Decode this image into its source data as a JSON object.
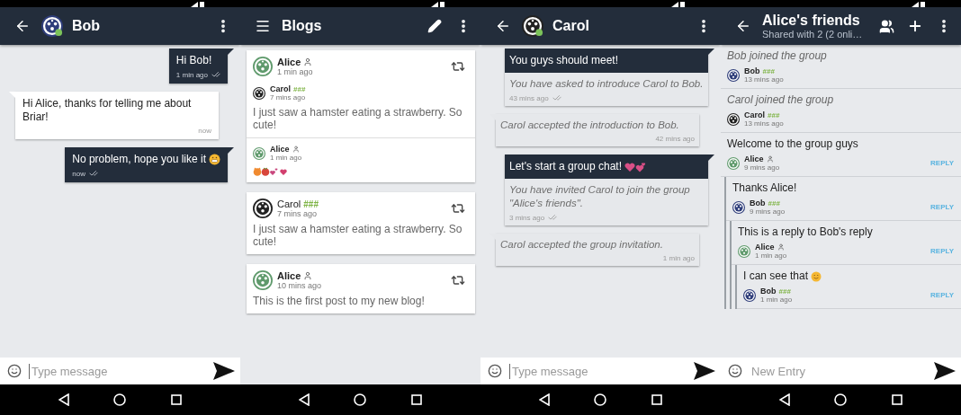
{
  "screens": [
    {
      "kind": "chat",
      "toolbar": {
        "back": true,
        "title": "Bob",
        "avatar": {
          "color": "#2e3d7a",
          "online": true
        }
      },
      "messages": [
        {
          "kind": "text",
          "outgoing": true,
          "text": "Hi Bob!",
          "time": "1 min ago",
          "delivered": true
        },
        {
          "kind": "text",
          "outgoing": false,
          "text": "Hi Alice, thanks for telling me about Briar!",
          "time": "now",
          "delivered": false
        },
        {
          "kind": "text",
          "outgoing": true,
          "text": "No problem, hope you like it",
          "emoji": {
            "kind": "grin"
          },
          "time": "now",
          "delivered": true
        }
      ],
      "composer": {
        "placeholder": "Type message",
        "cursor": true
      }
    },
    {
      "kind": "blogs",
      "toolbar": {
        "menu": true,
        "title": "Blogs",
        "edit": true
      },
      "posts": [
        {
          "author": {
            "name": "Alice",
            "self": true,
            "color": "#5f9a6c"
          },
          "time": "1 min ago",
          "reblog": {
            "author": {
              "name": "Carol",
              "trust": "###",
              "color": "#222222"
            },
            "time": "7 mins ago",
            "text": "I just saw a hamster eating a strawberry. So cute!"
          },
          "comments": [
            {
              "author": {
                "name": "Alice",
                "self": true,
                "color": "#5f9a6c"
              },
              "time": "1 min ago",
              "emoji": {
                "kind": "animals"
              }
            }
          ]
        },
        {
          "author": {
            "name": "Carol",
            "trust": "###",
            "color": "#222222"
          },
          "time": "7 mins ago",
          "text": "I just saw a hamster eating a strawberry. So cute!"
        },
        {
          "author": {
            "name": "Alice",
            "self": true,
            "color": "#5f9a6c"
          },
          "time": "10 mins ago",
          "text": "This is the first post to my new blog!"
        }
      ]
    },
    {
      "kind": "chat",
      "toolbar": {
        "back": true,
        "title": "Carol",
        "avatar": {
          "color": "#222222",
          "online": true
        }
      },
      "messages": [
        {
          "kind": "intro",
          "outgoing": true,
          "text": "You guys should meet!",
          "note": "You have asked to introduce Carol to Bob.",
          "time": "43 mins ago",
          "delivered": true
        },
        {
          "kind": "notice",
          "outgoing": false,
          "note": "Carol accepted the introduction to Bob.",
          "time": "42 mins ago",
          "delivered": false
        },
        {
          "kind": "intro",
          "outgoing": true,
          "text": "Let's start a group chat!",
          "emoji": {
            "kind": "hearts"
          },
          "note": "You have invited Carol to join the group \"Alice's friends\".",
          "time": "3 mins ago",
          "delivered": true
        },
        {
          "kind": "notice",
          "outgoing": false,
          "note": "Carol accepted the group invitation.",
          "time": "1 min ago",
          "delivered": false
        }
      ],
      "composer": {
        "placeholder": "Type message",
        "cursor": true
      }
    },
    {
      "kind": "forum",
      "toolbar": {
        "back": true,
        "title": "Alice's friends",
        "subtitle": "Shared with 2 (2 onli…",
        "members": true,
        "add": true
      },
      "entries": [
        {
          "kind": "notice",
          "text": "Bob joined the group",
          "author": {
            "name": "Bob",
            "trust": "###",
            "color": "#2e3d7a"
          },
          "time": "13 mins ago"
        },
        {
          "kind": "notice",
          "text": "Carol joined the group",
          "author": {
            "name": "Carol",
            "trust": "###",
            "color": "#222222"
          },
          "time": "13 mins ago"
        },
        {
          "kind": "post",
          "text": "Welcome to the group guys",
          "author": {
            "name": "Alice",
            "self": true,
            "color": "#5f9a6c"
          },
          "time": "9 mins ago",
          "action": "REPLY",
          "children": [
            {
              "kind": "post",
              "text": "Thanks Alice!",
              "author": {
                "name": "Bob",
                "trust": "###",
                "color": "#2e3d7a"
              },
              "time": "9 mins ago",
              "action": "REPLY",
              "children": [
                {
                  "kind": "post",
                  "text": "This is a reply to Bob's reply",
                  "author": {
                    "name": "Alice",
                    "self": true,
                    "color": "#5f9a6c"
                  },
                  "time": "1 min ago",
                  "action": "REPLY",
                  "children": [
                    {
                      "kind": "post",
                      "text": "I can see that",
                      "emoji": {
                        "kind": "smile"
                      },
                      "author": {
                        "name": "Bob",
                        "trust": "###",
                        "color": "#2e3d7a"
                      },
                      "time": "1 min ago",
                      "action": "REPLY"
                    }
                  ]
                }
              ]
            }
          ]
        }
      ],
      "composer": {
        "placeholder": "New Entry",
        "cursor": false
      }
    }
  ]
}
